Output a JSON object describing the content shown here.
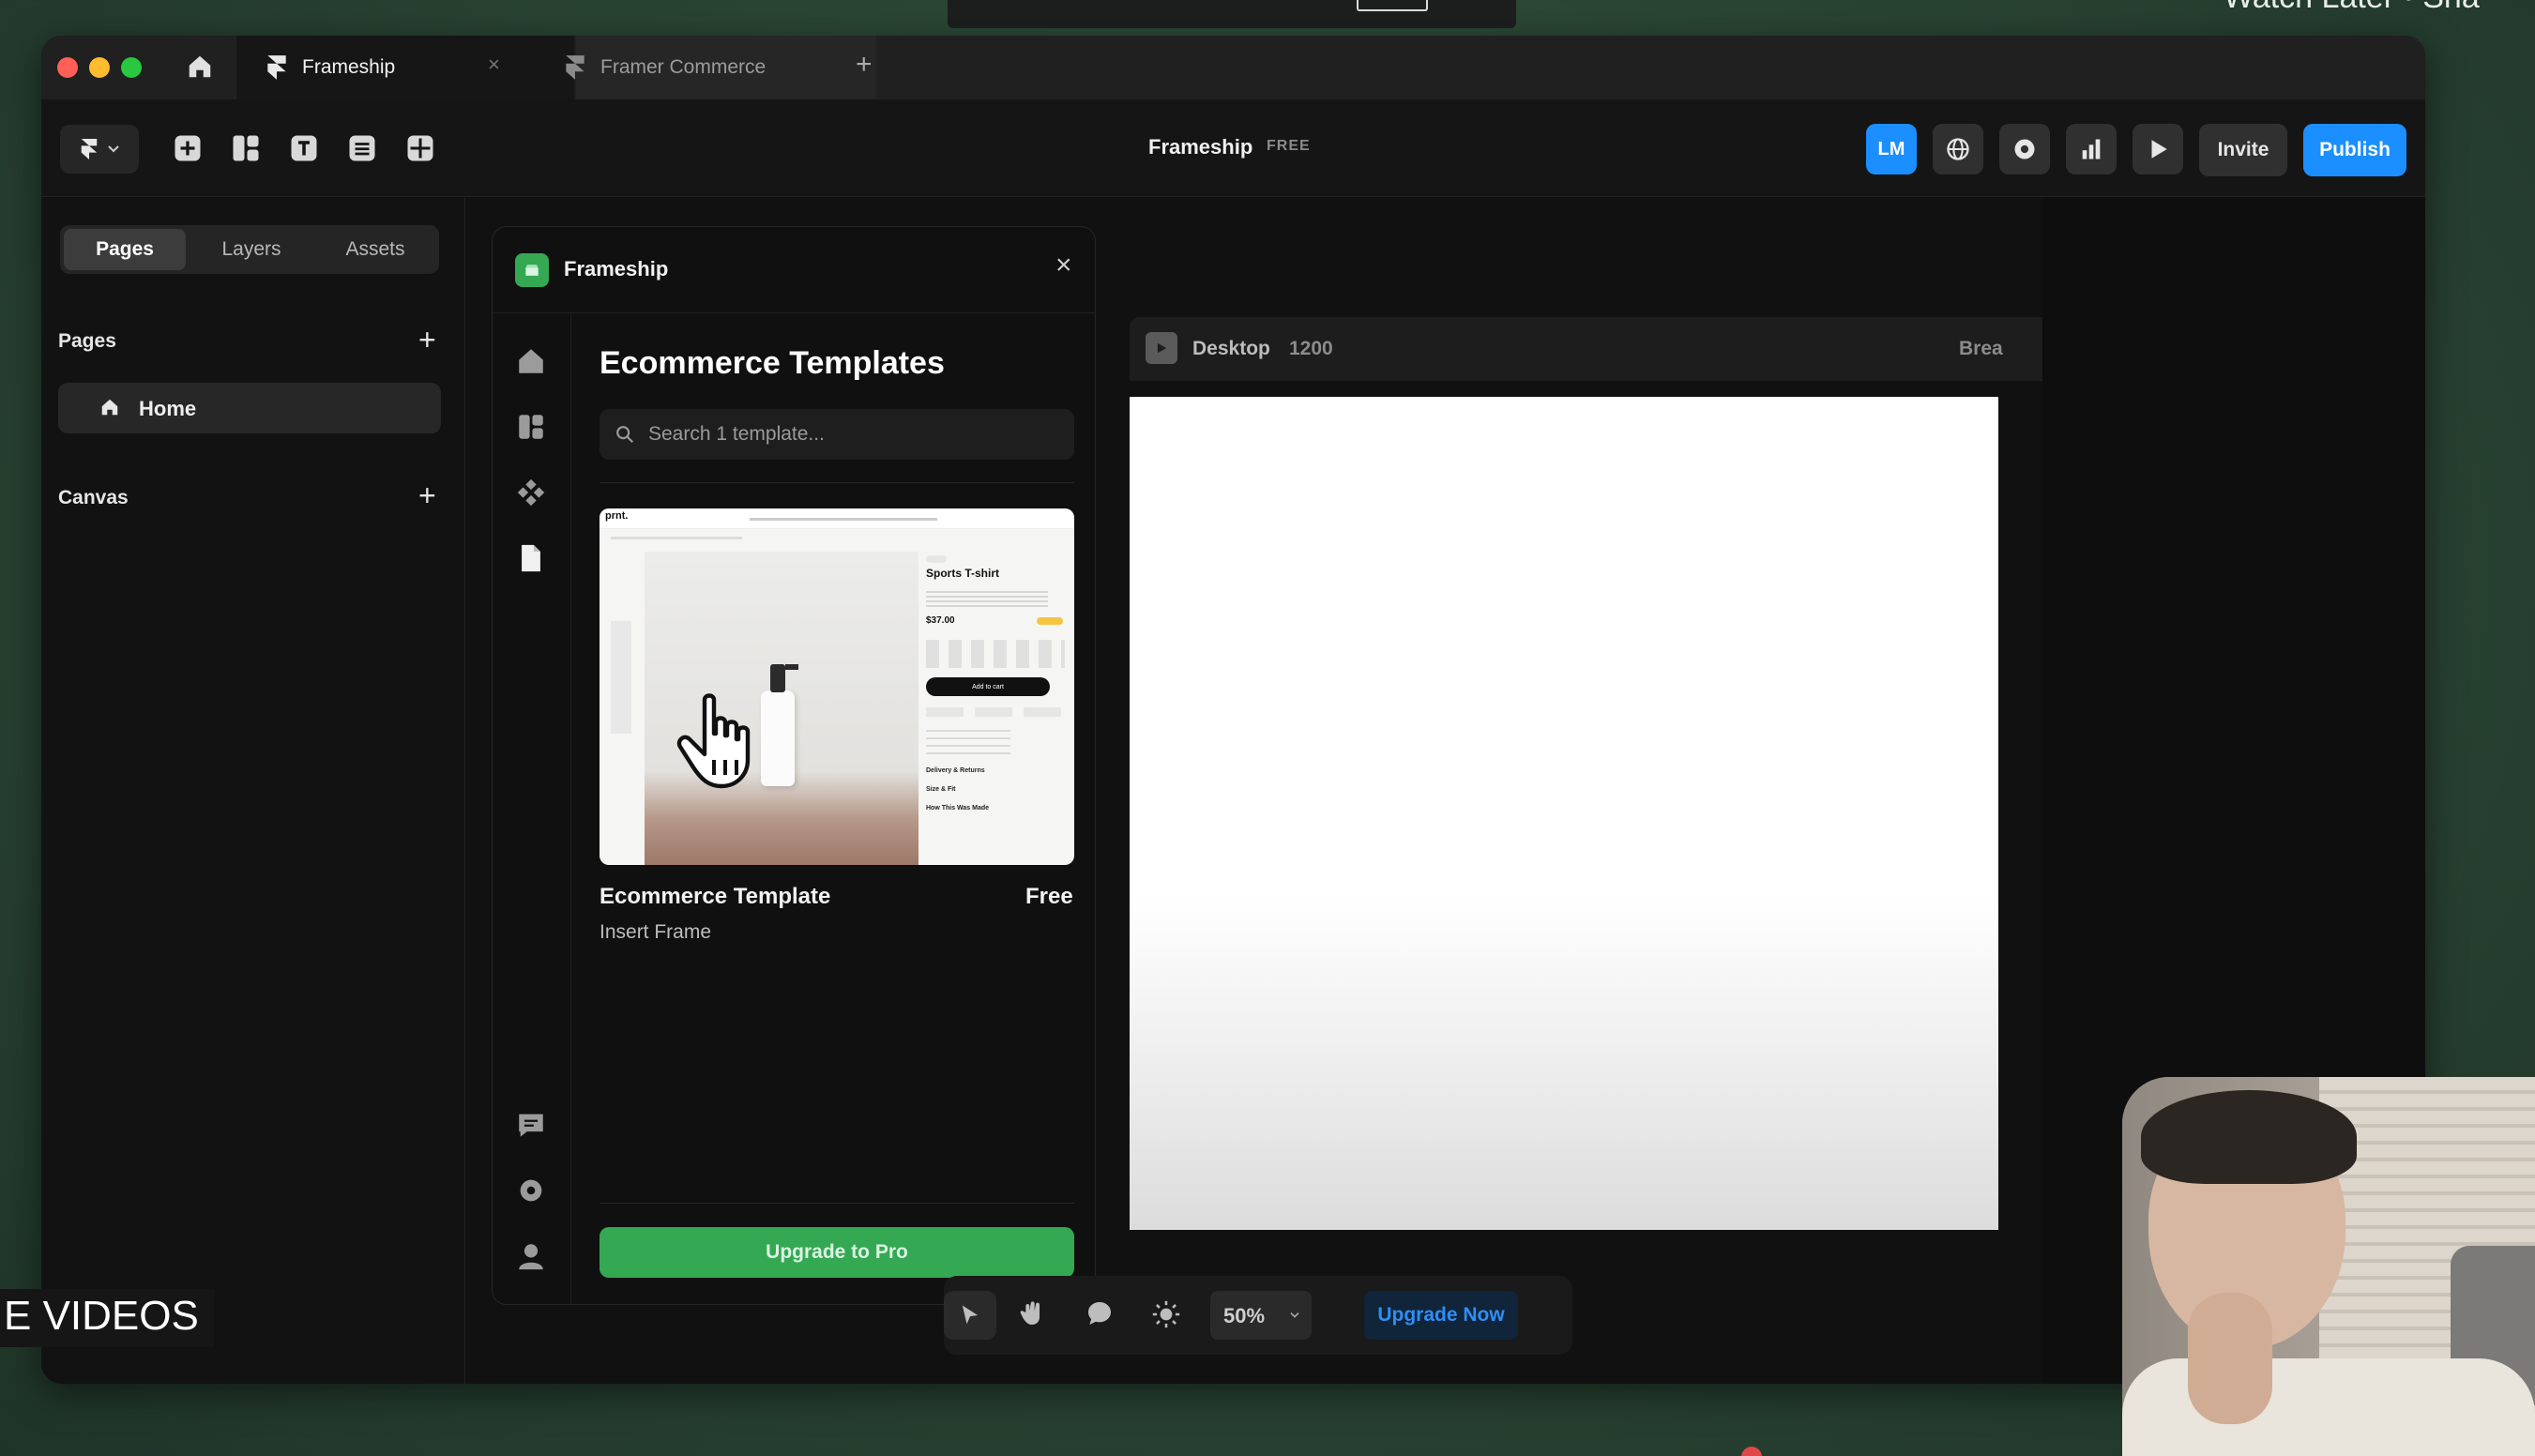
{
  "overlay": {
    "top_right_text": "Watch Later · Sha",
    "bottom_caption": "E VIDEOS"
  },
  "browser": {
    "tabs": [
      {
        "label": "Frameship",
        "close": "×"
      },
      {
        "label": "Framer Commerce"
      }
    ],
    "new_tab": "+"
  },
  "toolbar": {
    "project_name": "Frameship",
    "plan_badge": "FREE",
    "avatar_initials": "LM",
    "invite_label": "Invite",
    "publish_label": "Publish"
  },
  "sidebar": {
    "tabs": [
      "Pages",
      "Layers",
      "Assets"
    ],
    "active_tab": "Pages",
    "pages_title": "Pages",
    "pages": [
      {
        "label": "Home"
      }
    ],
    "canvas_title": "Canvas",
    "add": "+"
  },
  "plugin": {
    "title": "Frameship",
    "close": "×",
    "heading": "Ecommerce Templates",
    "search_placeholder": "Search 1 template...",
    "template": {
      "title": "Ecommerce Template",
      "price": "Free",
      "action": "Insert Frame",
      "preview": {
        "brand": "prnt.",
        "product_name": "Sports T-shirt",
        "price": "$37.00",
        "add_to_cart": "Add to cart",
        "accordion": [
          "Delivery & Returns",
          "Size & Fit",
          "How This Was Made"
        ]
      }
    },
    "upgrade_label": "Upgrade to Pro"
  },
  "canvas": {
    "breakpoint_label": "Desktop",
    "breakpoint_width": "1200",
    "breakpoint_right": "Brea"
  },
  "bottom_toolbar": {
    "zoom": "50%",
    "upgrade_label": "Upgrade Now"
  },
  "colors": {
    "accent": "#1b8fff",
    "upgrade_green": "#34a853",
    "background": "#2c4836"
  }
}
